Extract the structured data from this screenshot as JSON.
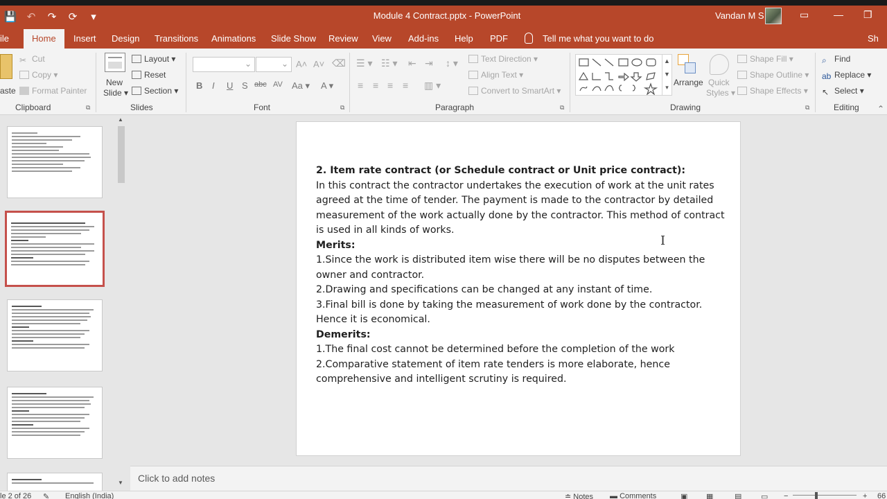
{
  "titlebar": {
    "doc_title": "Module 4 Contract.pptx  -  PowerPoint",
    "user": "Vandan M S",
    "qat": [
      "💾",
      "↶",
      "↷",
      "⟳",
      "▾"
    ],
    "window_buttons": [
      "▭",
      "—",
      "❐"
    ]
  },
  "tabs": {
    "file": "ile",
    "home": "Home",
    "insert": "Insert",
    "design": "Design",
    "transitions": "Transitions",
    "animations": "Animations",
    "slideshow": "Slide Show",
    "review": "Review",
    "view": "View",
    "addins": "Add-ins",
    "help": "Help",
    "pdf": "PDF",
    "tellme": "Tell me what you want to do",
    "share": "Sh"
  },
  "ribbon": {
    "clipboard": {
      "paste": "aste",
      "cut": "Cut",
      "copy": "Copy",
      "format_painter": "Format Painter",
      "label": "Clipboard"
    },
    "slides": {
      "new_slide": "New",
      "new_slide2": "Slide",
      "layout": "Layout",
      "reset": "Reset",
      "section": "Section",
      "label": "Slides"
    },
    "font": {
      "bold": "B",
      "italic": "I",
      "underline": "U",
      "shadow": "S",
      "strike": "abc",
      "spacing": "AV",
      "case": "Aa",
      "color": "A",
      "label": "Font"
    },
    "paragraph": {
      "text_direction": "Text Direction",
      "align_text": "Align Text",
      "smartart": "Convert to SmartArt",
      "label": "Paragraph"
    },
    "drawing": {
      "arrange": "Arrange",
      "quick_styles": "Quick",
      "quick_styles2": "Styles",
      "shape_fill": "Shape Fill",
      "shape_outline": "Shape Outline",
      "shape_effects": "Shape Effects",
      "label": "Drawing"
    },
    "editing": {
      "find": "Find",
      "replace": "Replace",
      "select": "Select",
      "label": "Editing"
    }
  },
  "slide": {
    "heading": "2. Item rate contract (or Schedule  contract or Unit price contract):",
    "intro": "In this contract the contractor undertakes the execution of work at the unit rates agreed at the time of tender. The payment is made to the contractor by detailed measurement of the work actually done by the contractor. This method of contract is used in all kinds of works.",
    "merits_title": "Merits:",
    "merits": [
      "1.Since the work is distributed item wise there will be no disputes between the owner and contractor.",
      "2.Drawing and specifications can be changed at any instant of time.",
      "3.Final bill is done by taking the measurement of work done by the contractor. Hence it is economical."
    ],
    "demerits_title": "Demerits:",
    "demerits": [
      "1.The final cost cannot be determined before the completion of the work",
      "2.Comparative statement of item rate tenders is more elaborate, hence comprehensive and intelligent scrutiny is required."
    ]
  },
  "notes": {
    "placeholder": "Click to add notes"
  },
  "statusbar": {
    "slide_info": "le 2 of 26",
    "language": "English (India)",
    "notes": "Notes",
    "comments": "Comments",
    "zoom_minus": "−",
    "zoom_plus": "+",
    "zoom_value": "66"
  },
  "colors": {
    "accent": "#b7472a",
    "selected_thumb": "#c5504b"
  }
}
